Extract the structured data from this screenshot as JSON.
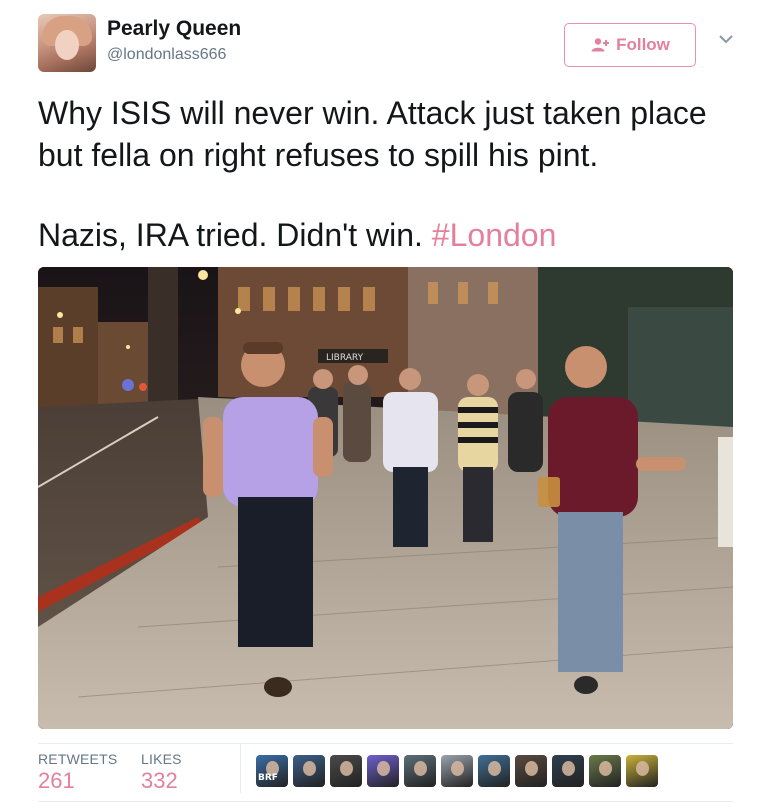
{
  "tweet": {
    "author": {
      "display_name": "Pearly Queen",
      "handle": "@londonlass666"
    },
    "follow_button": {
      "label": "Follow",
      "icon": "add-user-icon"
    },
    "menu_icon": "chevron-down-icon",
    "text_line1": "Why ISIS will never win. Attack just taken place but fella on right refuses to spill his pint.",
    "text_line2_prefix": "Nazis, IRA tried. Didn't win. ",
    "hashtag": "#London",
    "photo": {
      "sign_text": "LIBRARY"
    },
    "stats": {
      "retweets_label": "RETWEETS",
      "retweets_value": "261",
      "likes_label": "LIKES",
      "likes_value": "332"
    },
    "likers": [
      {
        "tag": "BRF",
        "color": "#3a6ea8"
      },
      {
        "tag": "",
        "color": "#3b5f8a"
      },
      {
        "tag": "",
        "color": "#4a4a4a"
      },
      {
        "tag": "",
        "color": "#6f5fd0"
      },
      {
        "tag": "",
        "color": "#5c6f7a"
      },
      {
        "tag": "",
        "color": "#9aa3ad"
      },
      {
        "tag": "",
        "color": "#3f6f96"
      },
      {
        "tag": "",
        "color": "#5a4a40"
      },
      {
        "tag": "",
        "color": "#2f3f50"
      },
      {
        "tag": "",
        "color": "#6a7a4a"
      },
      {
        "tag": "",
        "color": "#c9b23a"
      }
    ],
    "colors": {
      "accent": "#e3819d",
      "text": "#14171a",
      "muted": "#657786"
    }
  }
}
